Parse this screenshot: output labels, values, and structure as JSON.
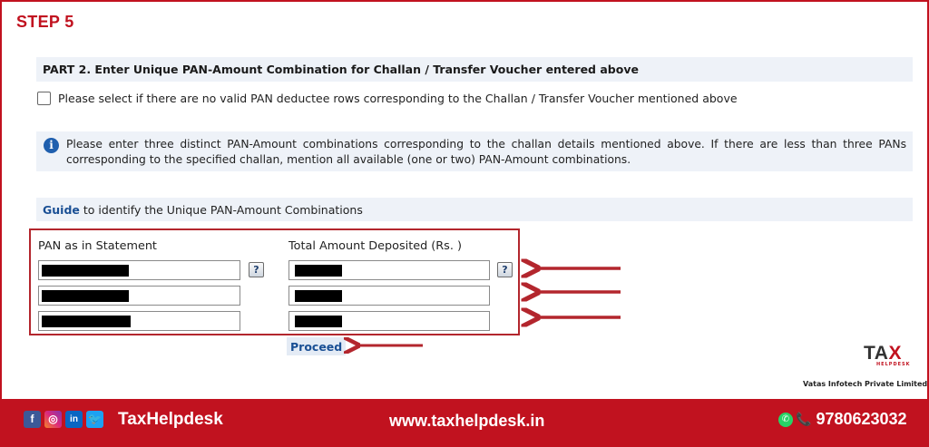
{
  "step_title": "STEP 5",
  "part": {
    "title": "PART 2. Enter Unique PAN-Amount Combination for Challan / Transfer Voucher entered above"
  },
  "no_valid_pan_checkbox": {
    "label": "Please select if there are no valid PAN deductee rows corresponding to the Challan / Transfer Voucher mentioned above",
    "checked": false
  },
  "info": {
    "icon": "info-icon",
    "text": "Please enter three distinct PAN-Amount combinations corresponding to the challan details mentioned above. If there are less than three PANs corresponding to the specified challan, mention all available (one or two) PAN-Amount combinations."
  },
  "guide": {
    "link_text": "Guide",
    "text": " to identify the Unique PAN-Amount Combinations"
  },
  "table": {
    "pan_header": "PAN as in Statement",
    "amount_header": "Total Amount Deposited (Rs. )",
    "help_symbol": "?",
    "rows": [
      {
        "pan": "",
        "amount": ""
      },
      {
        "pan": "",
        "amount": ""
      },
      {
        "pan": "",
        "amount": ""
      }
    ]
  },
  "proceed_label": "Proceed",
  "annotation_color": "#b3262d",
  "logo": {
    "main": "TA",
    "x": "X",
    "sub": "HELPDESK",
    "company": "Vatas Infotech Private Limited"
  },
  "footer": {
    "social": [
      {
        "icon": "facebook-icon",
        "glyph": "f"
      },
      {
        "icon": "instagram-icon",
        "glyph": "◎"
      },
      {
        "icon": "linkedin-icon",
        "glyph": "in"
      },
      {
        "icon": "twitter-icon",
        "glyph": "🐦"
      }
    ],
    "brand": "TaxHelpdesk",
    "website": "www.taxhelpdesk.in",
    "phone": "9780623032",
    "bg_color": "#c1121f"
  }
}
